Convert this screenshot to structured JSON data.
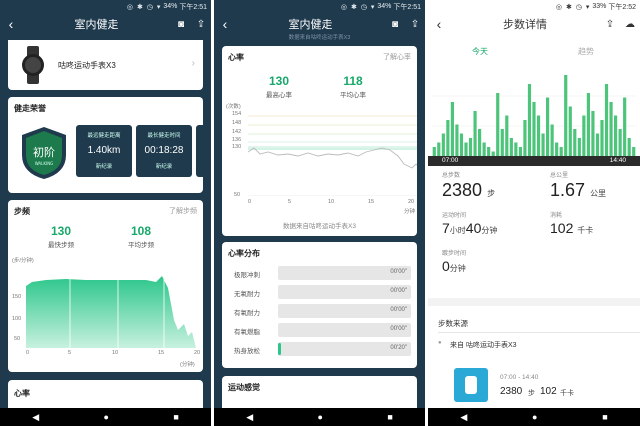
{
  "status": {
    "icons": "◎ ✱ ◷ ▾",
    "battery1": "34%",
    "time1": "下午2:51",
    "battery2": "34%",
    "time2": "下午2:51",
    "battery3": "33%",
    "time3": "下午2:52"
  },
  "screen1": {
    "title": "室内健走",
    "device_name": "咕咚运动手表X3",
    "honor": {
      "title": "健走荣誉",
      "badge_text": "初阶",
      "badge_sub": "WALKING",
      "tiles": [
        {
          "label": "最远健走距离",
          "value": "1.40km",
          "badge": "新纪录"
        },
        {
          "label": "最长健走时间",
          "value": "00:18:28",
          "badge": "新纪录"
        },
        {
          "label": "最",
          "value": "",
          "badge": "新"
        }
      ]
    },
    "cadence": {
      "title": "步频",
      "link": "了解步频",
      "max_value": "130",
      "max_label": "最快步频",
      "avg_value": "108",
      "avg_label": "平均步频",
      "unit": "(步/分钟)",
      "yticks": [
        "150",
        "100",
        "50"
      ],
      "xticks": [
        "0",
        "5",
        "10",
        "15",
        "20"
      ],
      "xunit": "(分钟)"
    },
    "next_card_title": "心率"
  },
  "screen2": {
    "title": "室内健走",
    "subtitle": "数据来自咕咚运动手表X3",
    "heart": {
      "title": "心率",
      "link": "了解心率",
      "max_value": "130",
      "max_label": "最高心率",
      "avg_value": "118",
      "avg_label": "平均心率",
      "unit": "(次数)",
      "yticks": [
        "154",
        "148",
        "142",
        "136",
        "130",
        "50"
      ],
      "xticks": [
        "0",
        "5",
        "10",
        "15",
        "20"
      ],
      "xunit": "分钟",
      "source": "数据来自咕咚运动手表X3"
    },
    "zones": {
      "title": "心率分布",
      "rows": [
        {
          "label": "极限冲刺",
          "time": "00'00\"",
          "fill": 0
        },
        {
          "label": "无氧耐力",
          "time": "00'00\"",
          "fill": 0
        },
        {
          "label": "有氧耐力",
          "time": "00'00\"",
          "fill": 0
        },
        {
          "label": "有氧燃脂",
          "time": "00'00\"",
          "fill": 0
        },
        {
          "label": "热身放松",
          "time": "00'20\"",
          "fill": 0.02
        }
      ]
    },
    "next_card_title": "运动感觉"
  },
  "screen3": {
    "title": "步数详情",
    "tabs": {
      "today": "今天",
      "trend": "趋势"
    },
    "chart_data": {
      "type": "bar",
      "x_start": "07:00",
      "x_end": "14:40",
      "values": [
        2,
        3,
        5,
        8,
        12,
        7,
        5,
        3,
        4,
        10,
        6,
        3,
        2,
        1,
        14,
        6,
        9,
        4,
        3,
        2,
        8,
        16,
        12,
        9,
        5,
        13,
        7,
        3,
        2,
        18,
        11,
        6,
        4,
        9,
        14,
        10,
        5,
        8,
        16,
        12,
        9,
        6,
        13,
        4,
        2
      ],
      "ymax": 20
    },
    "metrics": {
      "total_steps_label": "总步数",
      "total_steps_value": "2380",
      "total_steps_unit": "步",
      "total_km_label": "总公里",
      "total_km_value": "1.67",
      "total_km_unit": "公里",
      "time_label": "运动时间",
      "time_h": "7",
      "time_h_unit": "小时",
      "time_m": "40",
      "time_m_unit": "分钟",
      "cal_label": "消耗",
      "cal_value": "102",
      "cal_unit": "千卡",
      "sleep_label": "踱步时间",
      "sleep_value": "0",
      "sleep_unit": "分钟"
    },
    "source": {
      "title": "步数来源",
      "from": "来自 咕咚运动手表X3",
      "range": "07:00 - 14:40",
      "steps": "2380",
      "steps_unit": "步",
      "cal": "102",
      "cal_unit": "千卡"
    }
  },
  "colors": {
    "accent": "#17a86a",
    "dark": "#1f3a4d",
    "bar": "#4cc47a"
  }
}
